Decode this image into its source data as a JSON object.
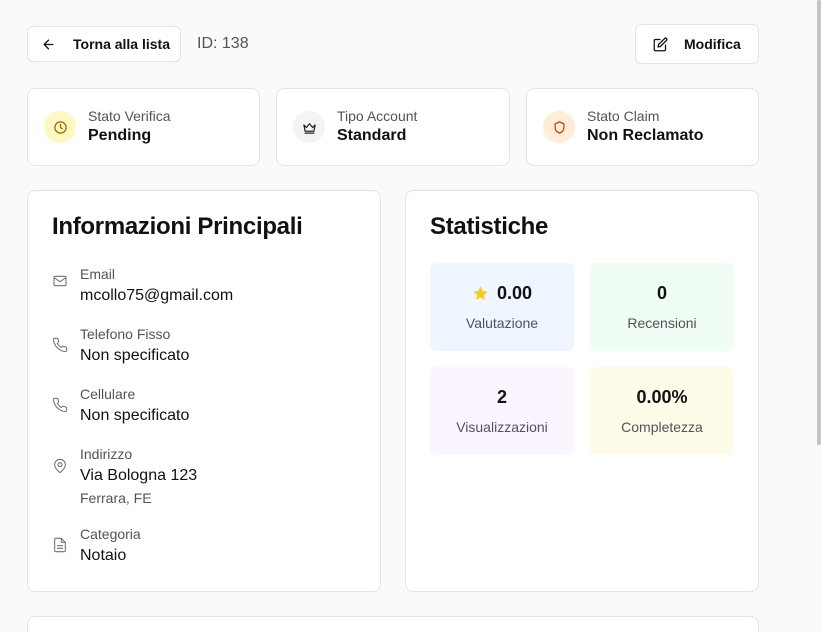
{
  "header": {
    "back_label": "Torna alla lista",
    "id_text": "ID: 138",
    "edit_label": "Modifica"
  },
  "status_cards": [
    {
      "label": "Stato Verifica",
      "value": "Pending",
      "icon": "clock-icon",
      "color": "#fef9c3"
    },
    {
      "label": "Tipo Account",
      "value": "Standard",
      "icon": "crown-icon",
      "color": "#f4f4f5"
    },
    {
      "label": "Stato Claim",
      "value": "Non Reclamato",
      "icon": "shield-icon",
      "color": "#ffedd5"
    }
  ],
  "info": {
    "title": "Informazioni Principali",
    "email": {
      "label": "Email",
      "value": "mcollo75@gmail.com"
    },
    "phone": {
      "label": "Telefono Fisso",
      "value": "Non specificato"
    },
    "mobile": {
      "label": "Cellulare",
      "value": "Non specificato"
    },
    "address": {
      "label": "Indirizzo",
      "value": "Via Bologna 123",
      "sub": "Ferrara, FE"
    },
    "category": {
      "label": "Categoria",
      "value": "Notaio"
    }
  },
  "stats": {
    "title": "Statistiche",
    "tiles": [
      {
        "value": "0.00",
        "label": "Valutazione",
        "bg": "#eff6ff"
      },
      {
        "value": "0",
        "label": "Recensioni",
        "bg": "#f0fdf4"
      },
      {
        "value": "2",
        "label": "Visualizzazioni",
        "bg": "#faf5ff"
      },
      {
        "value": "0.00%",
        "label": "Completezza",
        "bg": "#fefce8"
      }
    ]
  },
  "colors": {
    "star": "#facc15",
    "clock_stroke": "#a16207",
    "shield_stroke": "#c2410c"
  }
}
